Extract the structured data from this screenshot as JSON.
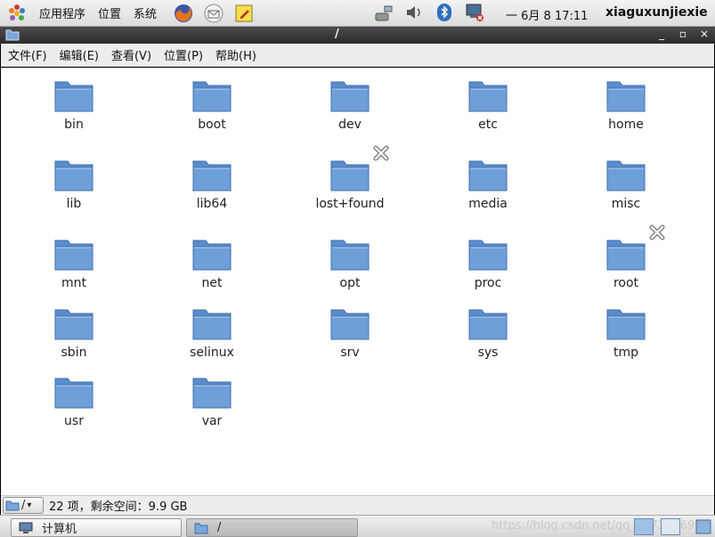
{
  "top_panel": {
    "menus": [
      "应用程序",
      "位置",
      "系统"
    ],
    "clock": "一 6月  8 17:11",
    "username": "xiaguxunjiexie",
    "launchers": [
      "firefox-icon",
      "mail-icon",
      "notes-icon"
    ],
    "tray": [
      "network-icon",
      "volume-icon",
      "bluetooth-icon",
      "display-error-icon"
    ]
  },
  "window": {
    "title": "/",
    "controls": [
      "_",
      "▫",
      "×"
    ]
  },
  "menubar": [
    "文件(F)",
    "编辑(E)",
    "查看(V)",
    "位置(P)",
    "帮助(H)"
  ],
  "files": [
    {
      "name": "bin"
    },
    {
      "name": "boot"
    },
    {
      "name": "dev"
    },
    {
      "name": "etc"
    },
    {
      "name": "home"
    },
    {
      "name": "lib"
    },
    {
      "name": "lib64"
    },
    {
      "name": "lost+found",
      "emblem": "no-access"
    },
    {
      "name": "media"
    },
    {
      "name": "misc"
    },
    {
      "name": "mnt"
    },
    {
      "name": "net"
    },
    {
      "name": "opt"
    },
    {
      "name": "proc"
    },
    {
      "name": "root",
      "emblem": "no-access"
    },
    {
      "name": "sbin"
    },
    {
      "name": "selinux"
    },
    {
      "name": "srv"
    },
    {
      "name": "sys"
    },
    {
      "name": "tmp"
    },
    {
      "name": "usr"
    },
    {
      "name": "var"
    }
  ],
  "statusbar": {
    "location": "/",
    "text": "22 项，剩余空间：9.9 GB"
  },
  "taskbar": {
    "tasks": [
      {
        "label": "计算机",
        "icon": "computer-icon"
      },
      {
        "label": "/",
        "icon": "folder-icon"
      }
    ],
    "watermark": "https://blog.csdn.net/qq_45712969..."
  },
  "colors": {
    "folder": "#6f9fd8",
    "titlebar": "#333333",
    "panel": "#e6e6e6"
  }
}
